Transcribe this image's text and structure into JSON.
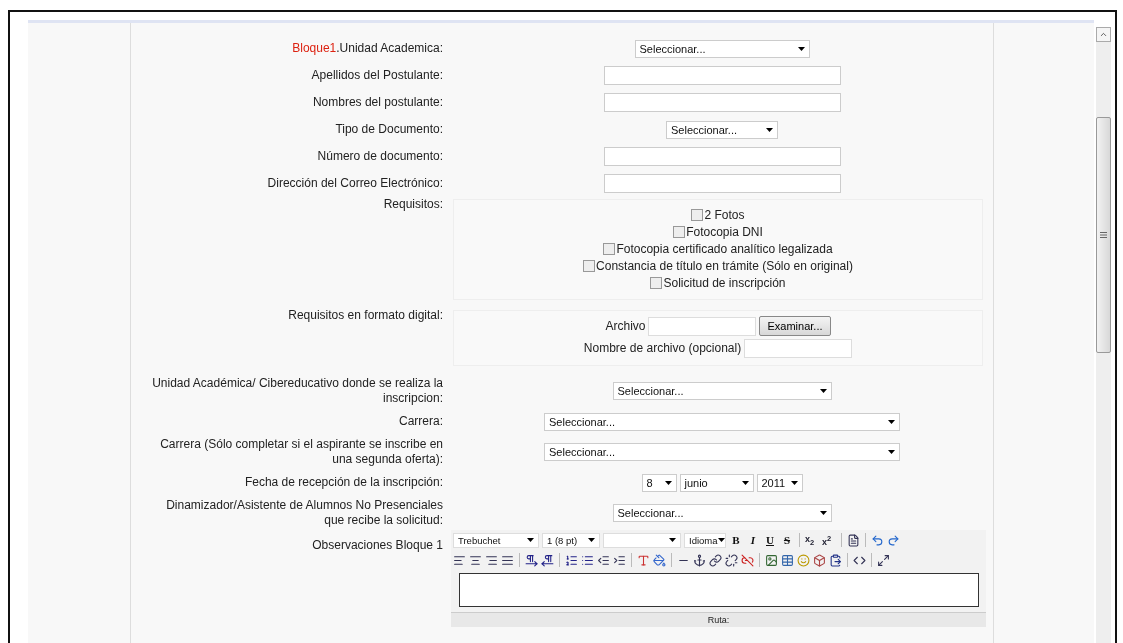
{
  "form": {
    "rows": [
      {
        "kind": "select",
        "label_prefix": "Bloque1",
        "label": ".Unidad Academica:",
        "value": "Seleccionar..."
      },
      {
        "kind": "text",
        "label": "Apellidos del Postulante:"
      },
      {
        "kind": "text",
        "label": "Nombres del postulante:"
      },
      {
        "kind": "select",
        "label": "Tipo de Documento:",
        "value": "Seleccionar..."
      },
      {
        "kind": "text",
        "label": "Número de documento:"
      },
      {
        "kind": "text",
        "label": "Dirección del Correo Electrónico:"
      },
      {
        "kind": "checklist",
        "label": "Requisitos:",
        "items": [
          {
            "label": "2 Fotos",
            "checked": false
          },
          {
            "label": "Fotocopia DNI",
            "checked": false
          },
          {
            "label": "Fotocopia certificado analítico legalizada",
            "checked": false
          },
          {
            "label": "Constancia de título en trámite (Sólo en original)",
            "checked": false
          },
          {
            "label": "Solicitud de inscripción",
            "checked": false
          }
        ]
      },
      {
        "kind": "file",
        "label": "Requisitos en formato digital:",
        "file_label": "Archivo",
        "button": "Examinar...",
        "name_label": "Nombre de archivo (opcional)"
      },
      {
        "kind": "select",
        "label": "Unidad Académica/ Cibereducativo donde se realiza la inscripcion:",
        "value": "Seleccionar..."
      },
      {
        "kind": "select",
        "label": "Carrera:",
        "value": "Seleccionar..."
      },
      {
        "kind": "select",
        "label": "Carrera (Sólo completar si el aspirante se inscribe en una segunda oferta):",
        "value": "Seleccionar..."
      },
      {
        "kind": "date",
        "label": "Fecha de recepción de la inscripción:",
        "day": "8",
        "month": "junio",
        "year": "2011"
      },
      {
        "kind": "select",
        "label": "Dinamizador/Asistente de Alumnos No Presenciales que recibe la solicitud:",
        "value": "Seleccionar..."
      },
      {
        "kind": "editor",
        "label": "Observaciones Bloque 1",
        "selects": [
          "Trebuchet",
          "1 (8 pt)",
          "Idioma"
        ],
        "format_buttons": [
          {
            "text": "B",
            "kind": "bold"
          },
          {
            "text": "I",
            "kind": "italic"
          },
          {
            "text": "U",
            "kind": "underline"
          },
          {
            "text": "S",
            "kind": "strike"
          }
        ],
        "script_buttons": [
          "x$_{2}$",
          "x$^{2}$"
        ],
        "status": "Ruta:"
      }
    ]
  }
}
